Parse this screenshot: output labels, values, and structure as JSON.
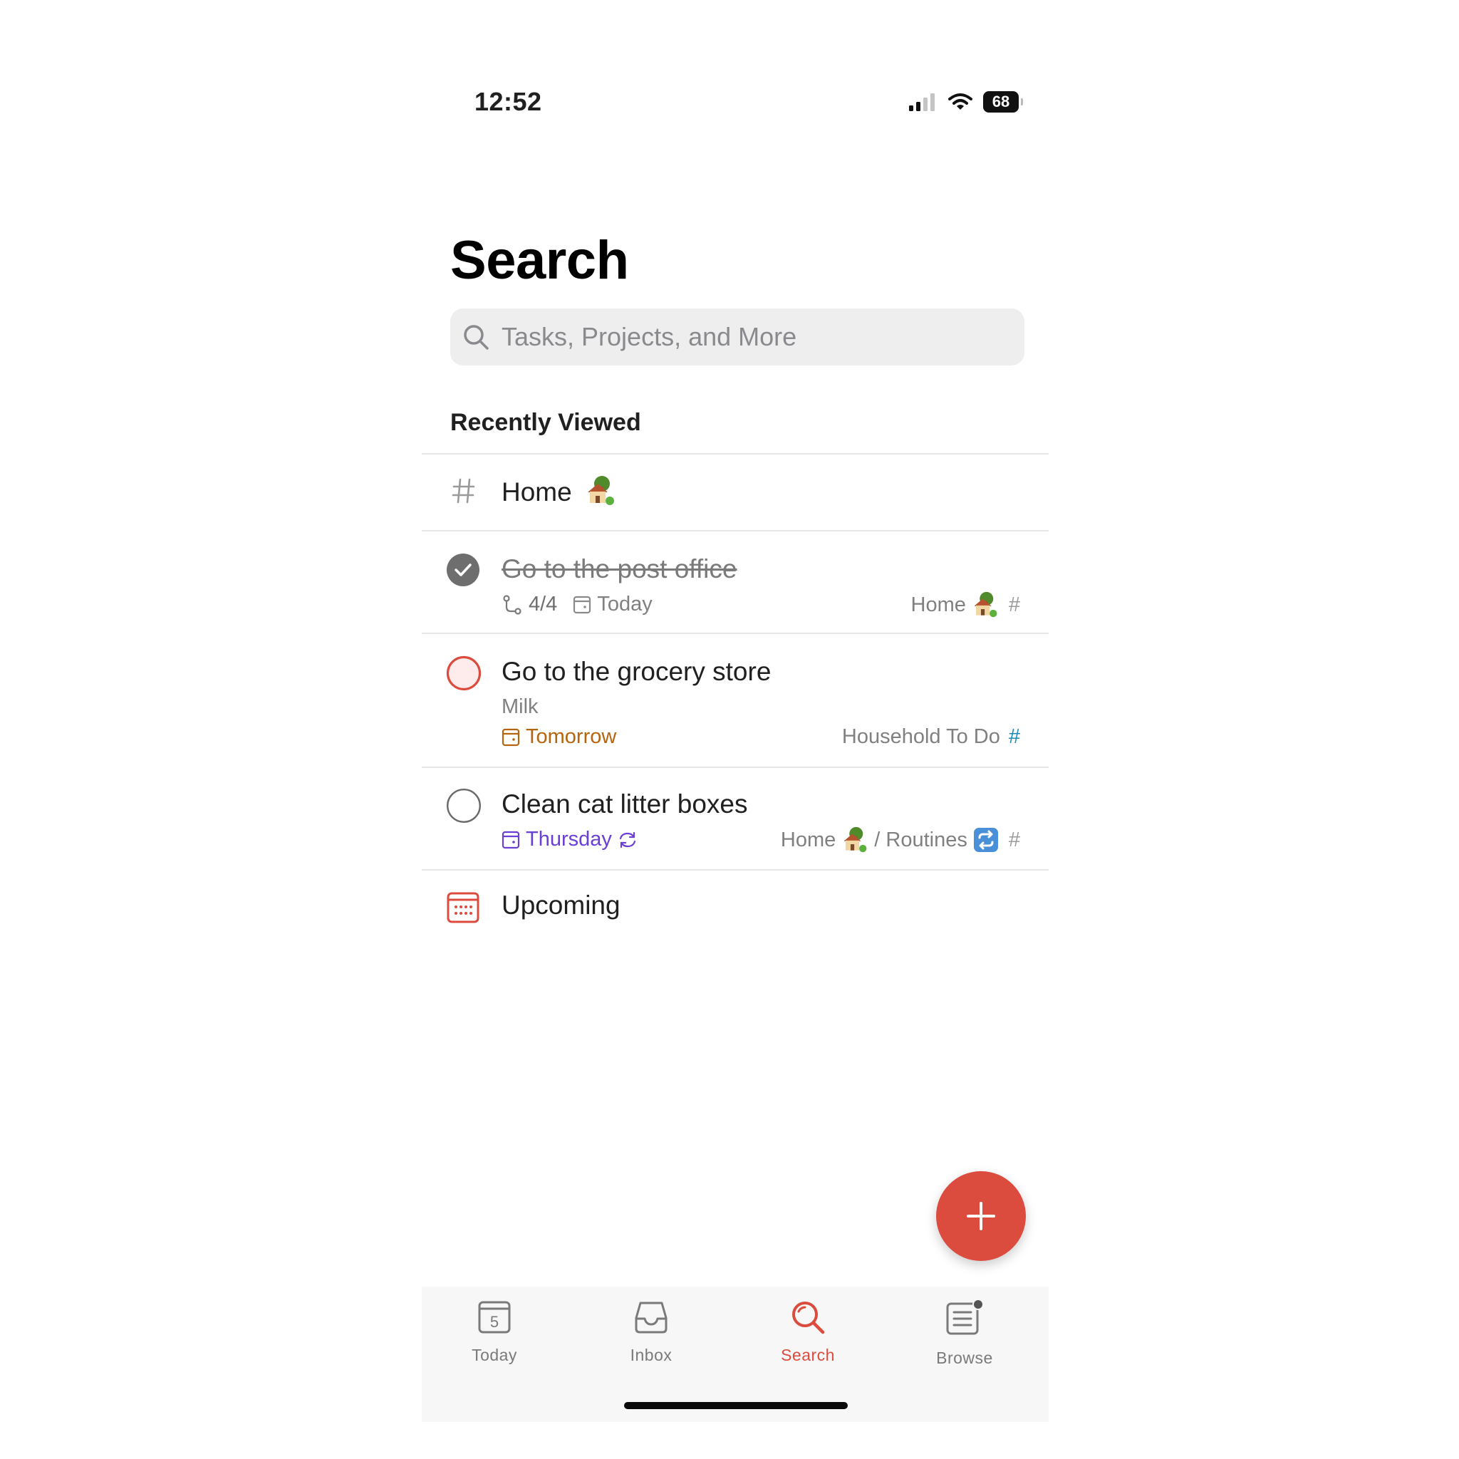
{
  "status_bar": {
    "time": "12:52",
    "battery": "68"
  },
  "header": {
    "title": "Search"
  },
  "search": {
    "placeholder": "Tasks, Projects, and More"
  },
  "recently_viewed": {
    "title": "Recently Viewed",
    "project_home": {
      "label": "Home"
    },
    "task_post_office": {
      "title": "Go to the post office",
      "subtasks": "4/4",
      "date": "Today",
      "project": "Home",
      "completed": true
    },
    "task_grocery": {
      "title": "Go to the grocery store",
      "description": "Milk",
      "date": "Tomorrow",
      "project": "Household To Do",
      "completed": false,
      "priority_color": "#dc4c3e"
    },
    "task_litter": {
      "title": "Clean cat litter boxes",
      "date": "Thursday",
      "project": "Home",
      "section": "/ Routines",
      "completed": false,
      "recurring": true
    },
    "upcoming": {
      "label": "Upcoming"
    }
  },
  "tabbar": {
    "today": {
      "label": "Today",
      "day": "5"
    },
    "inbox": {
      "label": "Inbox"
    },
    "search": {
      "label": "Search"
    },
    "browse": {
      "label": "Browse"
    }
  },
  "colors": {
    "accent": "#dc4c3e",
    "tomorrow": "#b5650f",
    "thursday": "#6b3fd4",
    "project_hash_blue": "#1a8ab8"
  }
}
